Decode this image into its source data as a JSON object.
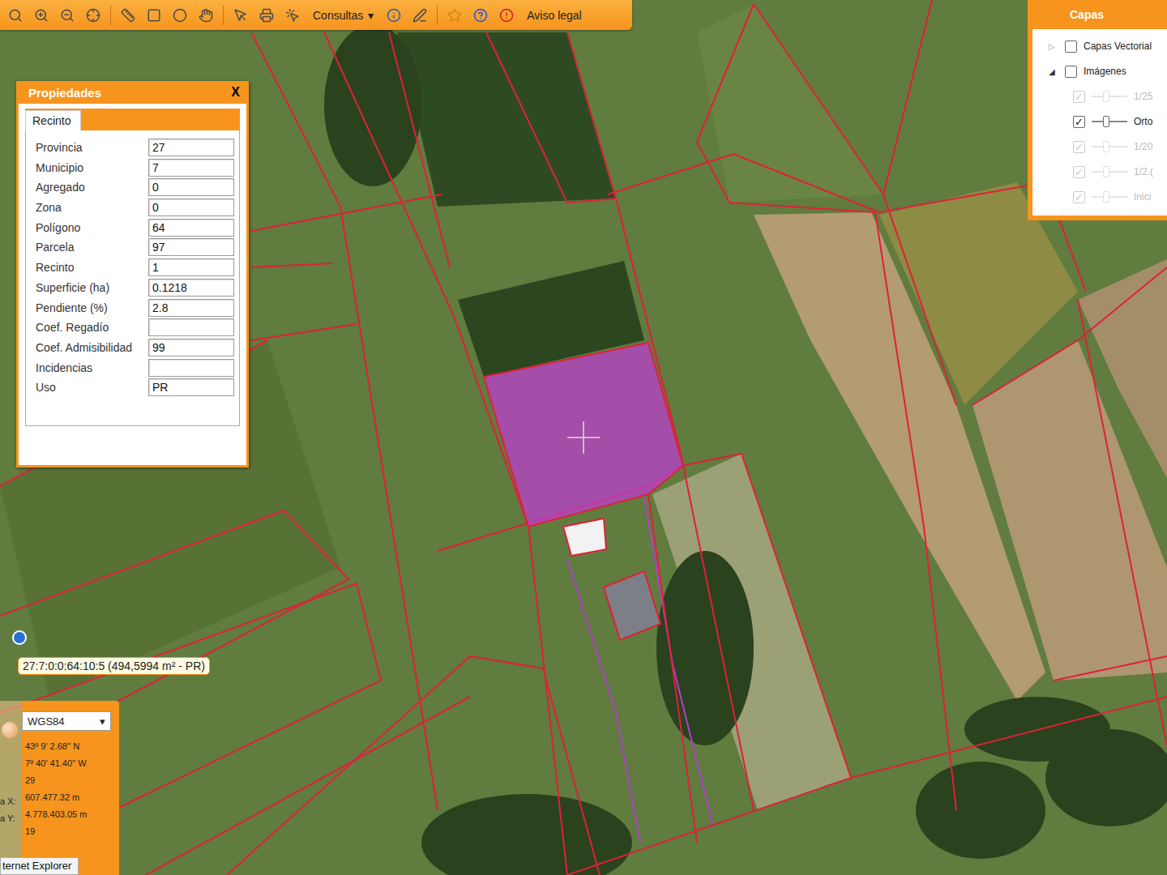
{
  "toolbar": {
    "menu": {
      "label": "Consultas",
      "arrow": "▾"
    },
    "legal": "Aviso legal"
  },
  "properties": {
    "title": "Propiedades",
    "close": "X",
    "tabs": [
      {
        "label": "Recinto",
        "selected": true
      }
    ],
    "fields": [
      {
        "label": "Provincia",
        "value": "27"
      },
      {
        "label": "Municipio",
        "value": "7"
      },
      {
        "label": "Agregado",
        "value": "0"
      },
      {
        "label": "Zona",
        "value": "0"
      },
      {
        "label": "Polígono",
        "value": "64"
      },
      {
        "label": "Parcela",
        "value": "97"
      },
      {
        "label": "Recinto",
        "value": "1"
      },
      {
        "label": "Superficie (ha)",
        "value": "0.1218"
      },
      {
        "label": "Pendiente (%)",
        "value": "2.8"
      },
      {
        "label": "Coef. Regadío",
        "value": ""
      },
      {
        "label": "Coef. Admisibilidad",
        "value": "99"
      },
      {
        "label": "Incidencias",
        "value": ""
      },
      {
        "label": "Uso",
        "value": "PR"
      }
    ]
  },
  "layers": {
    "title": "Capas",
    "items": [
      {
        "label": "Capas Vectorial",
        "toggle": "▷",
        "expanded": false,
        "checked": false
      },
      {
        "label": "Imágenes",
        "toggle": "◢",
        "expanded": true,
        "checked": false
      }
    ],
    "subitems": [
      {
        "label": "1/25",
        "checked": true,
        "disabled": true,
        "level": 0.4
      },
      {
        "label": "Orto",
        "checked": true,
        "disabled": false,
        "level": 0.4
      },
      {
        "label": "1/20",
        "checked": true,
        "disabled": true,
        "level": 0.4
      },
      {
        "label": "1/2.(",
        "checked": true,
        "disabled": true,
        "level": 0.4
      },
      {
        "label": "Inici",
        "checked": true,
        "disabled": true,
        "level": 0.4
      }
    ]
  },
  "tooltip": "27:7:0:0:64:10:5 (494,5994 m² - PR)",
  "coordinates": {
    "system": "WGS84",
    "arrow": "▾",
    "rows": [
      {
        "label": "",
        "value": "43º 9' 2.68'' N"
      },
      {
        "label": "",
        "value": "7º 40' 41.40'' W"
      },
      {
        "label": "",
        "value": "29"
      },
      {
        "label": "a X:",
        "value": "607.477.32 m"
      },
      {
        "label": "a Y:",
        "value": "4.778.403.05 m"
      },
      {
        "label": "",
        "value": "19"
      }
    ]
  },
  "taskbar": "ternet Explorer"
}
